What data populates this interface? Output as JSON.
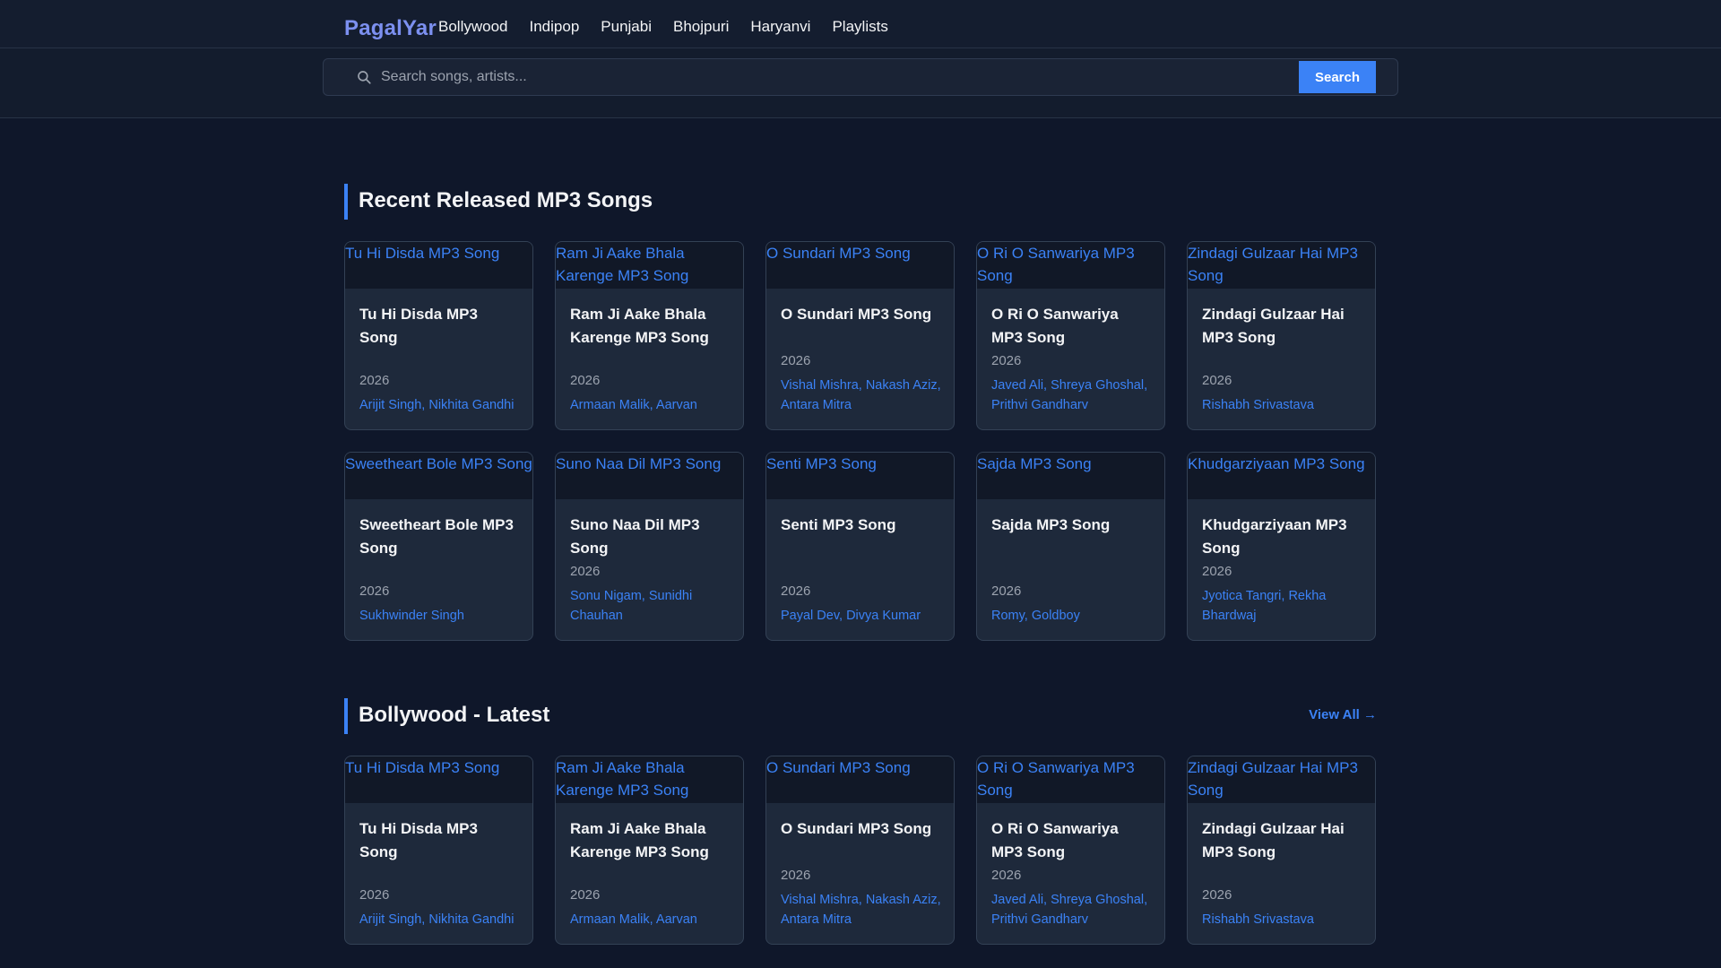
{
  "brand": {
    "logo": "PagalYar"
  },
  "nav": [
    {
      "label": "Bollywood"
    },
    {
      "label": "Indipop"
    },
    {
      "label": "Punjabi"
    },
    {
      "label": "Bhojpuri"
    },
    {
      "label": "Haryanvi"
    },
    {
      "label": "Playlists"
    }
  ],
  "search": {
    "placeholder": "Search songs, artists...",
    "button_label": "Search"
  },
  "sections": [
    {
      "title": "Recent Released MP3 Songs",
      "songs": [
        {
          "alt": "Tu Hi Disda MP3 Song",
          "title": "Tu Hi Disda MP3 Song",
          "year": "2026",
          "artists": "Arijit Singh, Nikhita Gandhi"
        },
        {
          "alt": "Ram Ji Aake Bhala Karenge MP3 Song",
          "title": "Ram Ji Aake Bhala Karenge MP3 Song",
          "year": "2026",
          "artists": "Armaan Malik, Aarvan"
        },
        {
          "alt": "O Sundari MP3 Song",
          "title": "O Sundari MP3 Song",
          "year": "2026",
          "artists": "Vishal Mishra, Nakash Aziz, Antara Mitra"
        },
        {
          "alt": "O Ri O Sanwariya MP3 Song",
          "title": "O Ri O Sanwariya MP3 Song",
          "year": "2026",
          "artists": "Javed Ali, Shreya Ghoshal, Prithvi Gandharv"
        },
        {
          "alt": "Zindagi Gulzaar Hai MP3 Song",
          "title": "Zindagi Gulzaar Hai MP3 Song",
          "year": "2026",
          "artists": "Rishabh Srivastava"
        },
        {
          "alt": "Sweetheart Bole MP3 Song",
          "title": "Sweetheart Bole MP3 Song",
          "year": "2026",
          "artists": "Sukhwinder Singh"
        },
        {
          "alt": "Suno Naa Dil MP3 Song",
          "title": "Suno Naa Dil MP3 Song",
          "year": "2026",
          "artists": "Sonu Nigam, Sunidhi Chauhan"
        },
        {
          "alt": "Senti MP3 Song",
          "title": "Senti MP3 Song",
          "year": "2026",
          "artists": "Payal Dev, Divya Kumar"
        },
        {
          "alt": "Sajda MP3 Song",
          "title": "Sajda MP3 Song",
          "year": "2026",
          "artists": "Romy, Goldboy"
        },
        {
          "alt": "Khudgarziyaan MP3 Song",
          "title": "Khudgarziyaan MP3 Song",
          "year": "2026",
          "artists": "Jyotica Tangri, Rekha Bhardwaj"
        }
      ]
    },
    {
      "title": "Bollywood - Latest",
      "view_all": "View All →",
      "songs": [
        {
          "alt": "Tu Hi Disda MP3 Song",
          "title": "Tu Hi Disda MP3 Song",
          "year": "2026",
          "artists": "Arijit Singh, Nikhita Gandhi"
        },
        {
          "alt": "Ram Ji Aake Bhala Karenge MP3 Song",
          "title": "Ram Ji Aake Bhala Karenge MP3 Song",
          "year": "2026",
          "artists": "Armaan Malik, Aarvan"
        },
        {
          "alt": "O Sundari MP3 Song",
          "title": "O Sundari MP3 Song",
          "year": "2026",
          "artists": "Vishal Mishra, Nakash Aziz, Antara Mitra"
        },
        {
          "alt": "O Ri O Sanwariya MP3 Song",
          "title": "O Ri O Sanwariya MP3 Song",
          "year": "2026",
          "artists": "Javed Ali, Shreya Ghoshal, Prithvi Gandharv"
        },
        {
          "alt": "Zindagi Gulzaar Hai MP3 Song",
          "title": "Zindagi Gulzaar Hai MP3 Song",
          "year": "2026",
          "artists": "Rishabh Srivastava"
        }
      ]
    }
  ],
  "colors": {
    "background": "#0f172a",
    "card": "#1e293b",
    "accent": "#3b82f6",
    "logo": "#7c90f0"
  }
}
